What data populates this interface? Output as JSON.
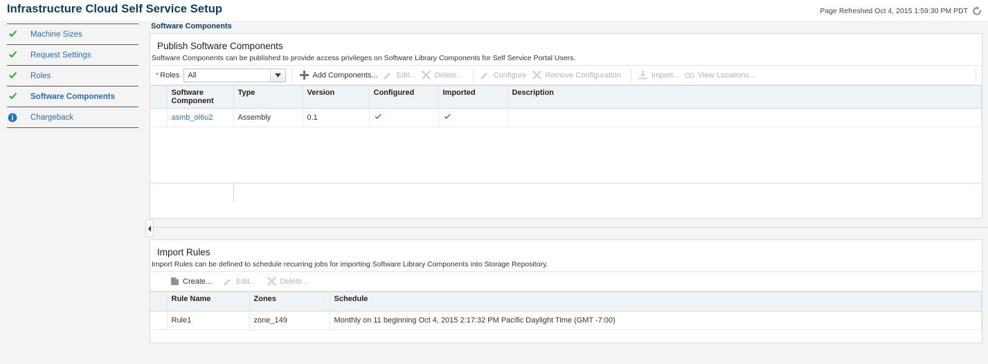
{
  "header": {
    "title": "Infrastructure Cloud Self Service Setup",
    "refresh_text": "Page Refreshed Oct 4, 2015 1:59:30 PM PDT",
    "refresh_icon": "refresh-icon"
  },
  "sidebar": {
    "items": [
      {
        "label": "Machine Sizes",
        "icon": "check-icon",
        "selected": false
      },
      {
        "label": "Request Settings",
        "icon": "check-icon",
        "selected": false
      },
      {
        "label": "Roles",
        "icon": "check-icon",
        "selected": false
      },
      {
        "label": "Software Components",
        "icon": "check-icon",
        "selected": true
      },
      {
        "label": "Chargeback",
        "icon": "info-icon",
        "selected": false
      }
    ]
  },
  "content": {
    "tab_label": "Software Components"
  },
  "publish_panel": {
    "title": "Publish Software Components",
    "description": "Software Components can be published to provide access privileges on Software Library Components for Self Service Portal Users.",
    "roles_filter": {
      "required_marker": "*",
      "label": "Roles",
      "value": "All",
      "options": [
        "All"
      ],
      "arrow_icon": "chevron-down-icon"
    },
    "toolbar": [
      {
        "label": "Add Components...",
        "icon": "plus-icon",
        "disabled": false
      },
      {
        "label": "Edit...",
        "icon": "pencil-icon",
        "disabled": true
      },
      {
        "label": "Delete...",
        "icon": "x-icon",
        "disabled": true
      },
      {
        "label": "Configure",
        "icon": "pencil-icon",
        "disabled": true
      },
      {
        "label": "Remove Configuration",
        "icon": "x-icon",
        "disabled": true
      },
      {
        "label": "Import...",
        "icon": "import-icon",
        "disabled": true
      },
      {
        "label": "View Locations...",
        "icon": "link-icon",
        "disabled": true
      }
    ],
    "table": {
      "columns": [
        "Software Component",
        "Type",
        "Version",
        "Configured",
        "Imported",
        "Description"
      ],
      "rows": [
        {
          "software_component": "asmb_ol6u2",
          "type": "Assembly",
          "version": "0.1",
          "configured": "check-icon",
          "imported": "check-icon",
          "description": ""
        }
      ]
    }
  },
  "import_rules_panel": {
    "title": "Import Rules",
    "description": "Import Rules can be defined to schedule recurring jobs for importing Software Library Components into Storage Repository.",
    "toolbar": [
      {
        "label": "Create...",
        "icon": "create-icon",
        "disabled": false
      },
      {
        "label": "Edit...",
        "icon": "pencil-icon",
        "disabled": true
      },
      {
        "label": "Delete...",
        "icon": "x-icon",
        "disabled": true
      }
    ],
    "table": {
      "columns": [
        "Rule Name",
        "Zones",
        "Schedule"
      ],
      "rows": [
        {
          "rule_name": "Rule1",
          "zones": "zone_149",
          "schedule": "Monthly on 11 beginning Oct 4, 2015 2:17:32 PM Pacific Daylight Time (GMT -7:00)"
        }
      ]
    }
  },
  "colors": {
    "title_blue": "#0b3c5d",
    "link_blue": "#2b6cb0",
    "check_green": "#3a9e33",
    "info_blue": "#1b74bb",
    "disabled_gray": "#b4b4b4"
  }
}
